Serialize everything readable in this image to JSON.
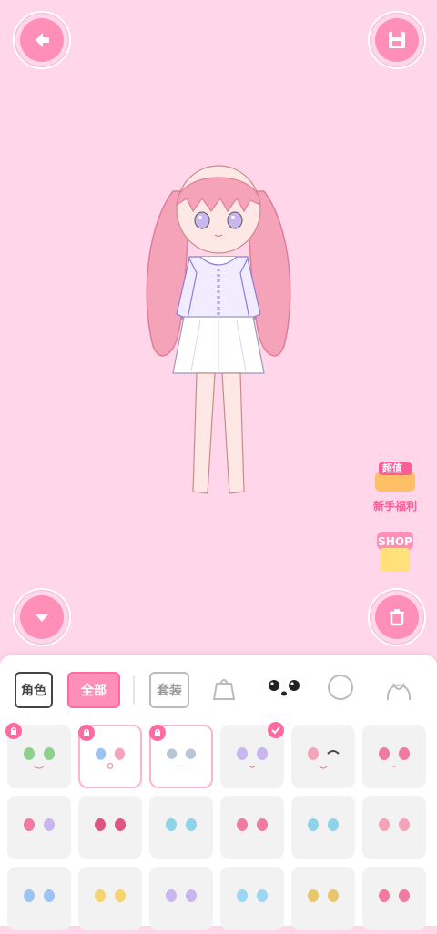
{
  "toolbar": {
    "back_icon": "back-arrow-icon",
    "save_icon": "save-floppy-icon",
    "collapse_icon": "chevron-down-icon",
    "delete_icon": "trash-icon"
  },
  "promos": {
    "welfare_badge_text": "超值",
    "welfare_label": "新手福利",
    "shop_label": "SHOP"
  },
  "tabs": {
    "role": "角色",
    "all": "全部",
    "outfit": "套装",
    "icons": [
      "bag-icon",
      "eyes-icon",
      "face-icon",
      "hair-icon"
    ]
  },
  "colors": {
    "bg_pink": "#ffd6ea",
    "accent_pink": "#ff8fb7",
    "dark_pink": "#ff5d9a"
  }
}
